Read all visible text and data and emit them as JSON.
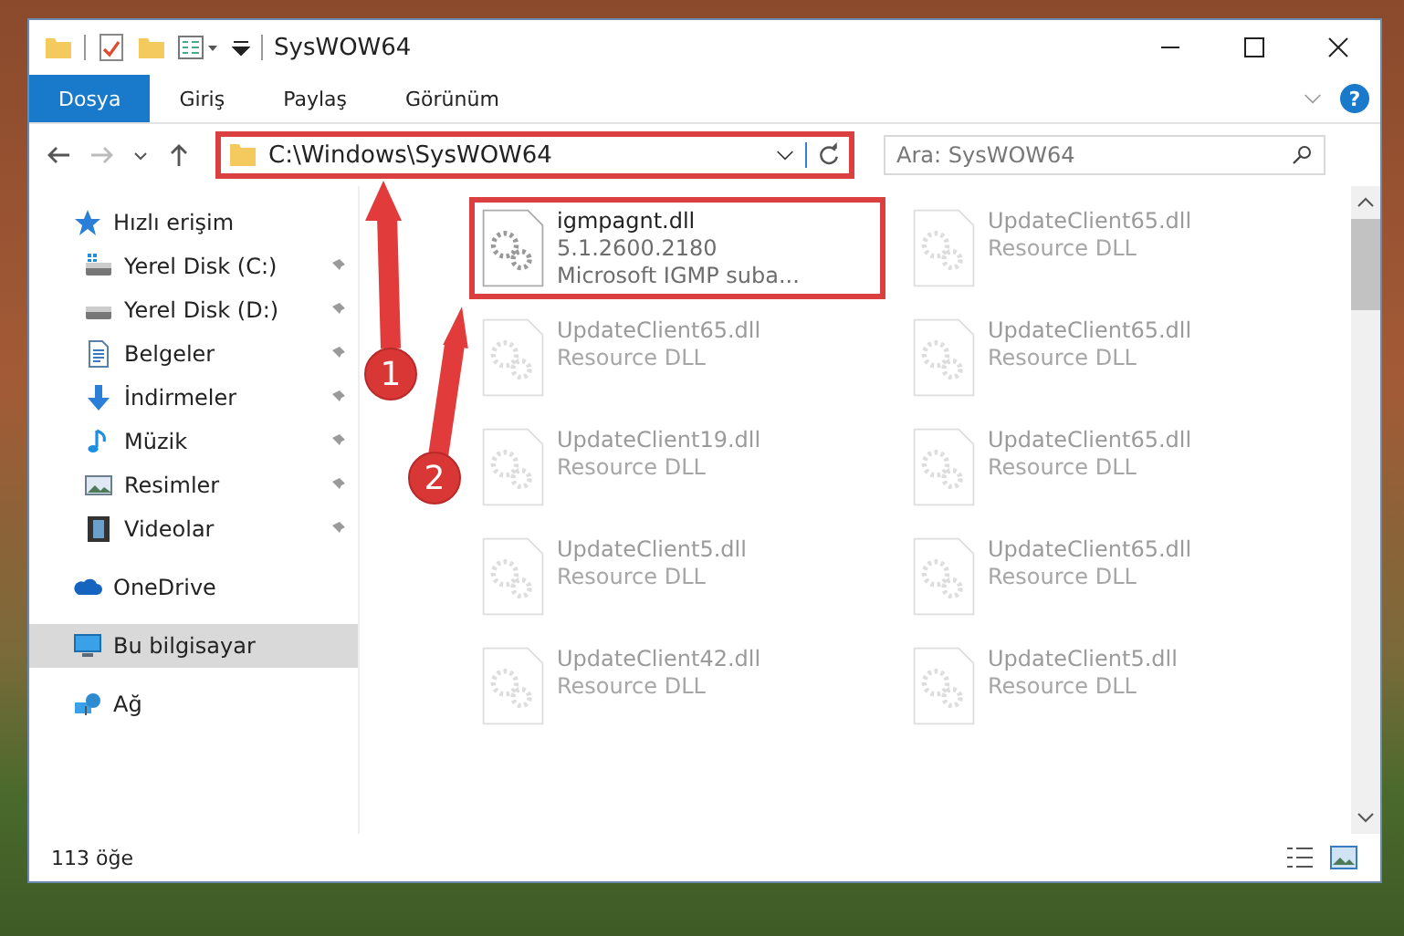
{
  "window": {
    "title": "SysWOW64"
  },
  "ribbon": {
    "tabs": [
      {
        "label": "Dosya",
        "selected": true
      },
      {
        "label": "Giriş",
        "selected": false
      },
      {
        "label": "Paylaş",
        "selected": false
      },
      {
        "label": "Görünüm",
        "selected": false
      }
    ],
    "help": "?"
  },
  "address_bar": {
    "path": "C:\\Windows\\SysWOW64",
    "highlighted": true
  },
  "search": {
    "placeholder": "Ara: SysWOW64"
  },
  "sidebar": {
    "items": [
      {
        "label": "Hızlı erişim",
        "kind": "star",
        "selected": false,
        "children": [
          {
            "label": "Yerel Disk (C:)",
            "kind": "system-drive",
            "pinned": true,
            "selected": false
          },
          {
            "label": "Yerel Disk (D:)",
            "kind": "drive",
            "pinned": true,
            "selected": false
          },
          {
            "label": "Belgeler",
            "kind": "document",
            "pinned": true,
            "selected": false
          },
          {
            "label": "İndirmeler",
            "kind": "download",
            "pinned": true,
            "selected": false
          },
          {
            "label": "Müzik",
            "kind": "music",
            "pinned": true,
            "selected": false
          },
          {
            "label": "Resimler",
            "kind": "picture",
            "pinned": true,
            "selected": false
          },
          {
            "label": "Videolar",
            "kind": "video",
            "pinned": true,
            "selected": false
          }
        ]
      },
      {
        "label": "OneDrive",
        "kind": "cloud",
        "selected": false
      },
      {
        "label": "Bu bilgisayar",
        "kind": "computer",
        "selected": true
      },
      {
        "label": "Ağ",
        "kind": "network",
        "selected": false
      }
    ]
  },
  "files": [
    {
      "name": "igmpagnt.dll",
      "version": "5.1.2600.2180",
      "description": "Microsoft IGMP suba...",
      "blurred": false,
      "highlighted": true
    },
    {
      "name": "UpdateClient65.dll",
      "description": "Resource DLL",
      "blurred": true,
      "highlighted": false
    },
    {
      "name": "UpdateClient65.dll",
      "description": "Resource DLL",
      "blurred": true,
      "highlighted": false
    },
    {
      "name": "UpdateClient65.dll",
      "description": "Resource DLL",
      "blurred": true,
      "highlighted": false
    },
    {
      "name": "UpdateClient19.dll",
      "description": "Resource DLL",
      "blurred": true,
      "highlighted": false
    },
    {
      "name": "UpdateClient65.dll",
      "description": "Resource DLL",
      "blurred": true,
      "highlighted": false
    },
    {
      "name": "UpdateClient5.dll",
      "description": "Resource DLL",
      "blurred": true,
      "highlighted": false
    },
    {
      "name": "UpdateClient65.dll",
      "description": "Resource DLL",
      "blurred": true,
      "highlighted": false
    },
    {
      "name": "UpdateClient42.dll",
      "description": "Resource DLL",
      "blurred": true,
      "highlighted": false
    },
    {
      "name": "UpdateClient5.dll",
      "description": "Resource DLL",
      "blurred": true,
      "highlighted": false
    }
  ],
  "status_bar": {
    "item_count": "113 öğe"
  },
  "annotations": [
    {
      "label": "1"
    },
    {
      "label": "2"
    }
  ]
}
